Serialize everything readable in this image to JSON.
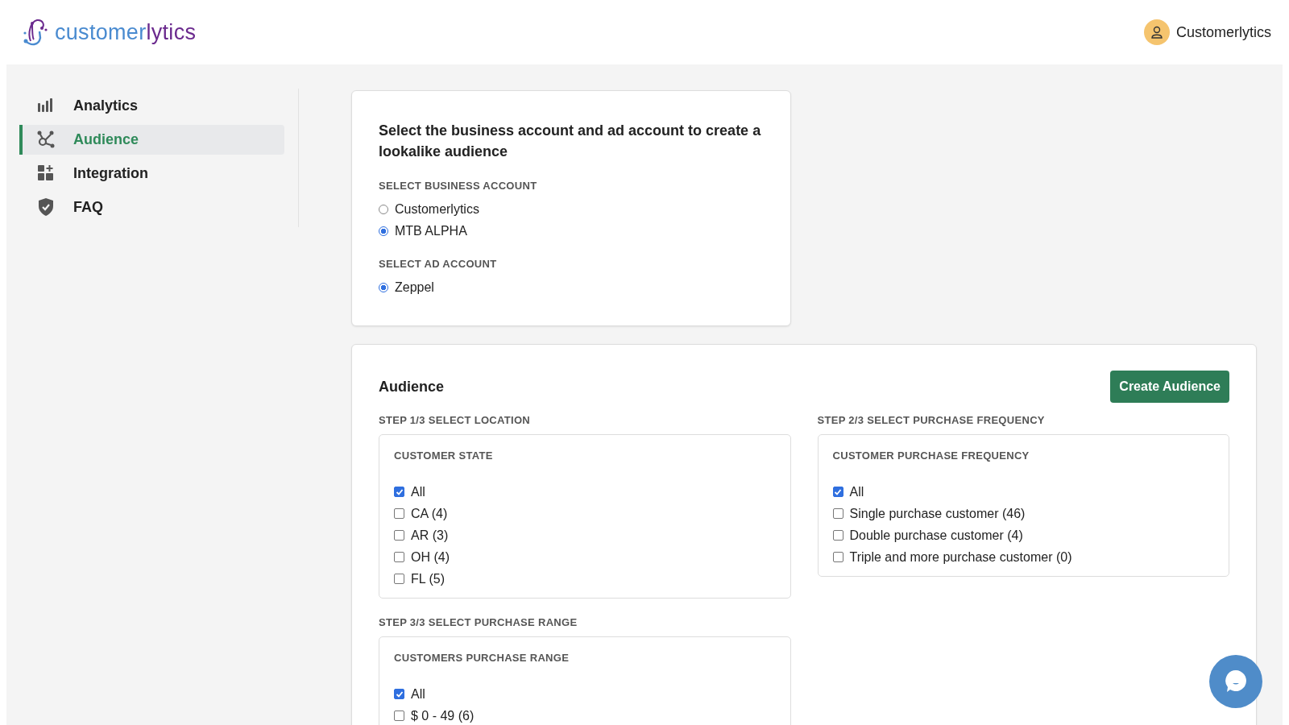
{
  "header": {
    "logo": [
      "customer",
      "lytics"
    ],
    "user_name": "Customerlytics"
  },
  "sidebar": {
    "items": [
      {
        "label": "Analytics",
        "selected": false
      },
      {
        "label": "Audience",
        "selected": true
      },
      {
        "label": "Integration",
        "selected": false
      },
      {
        "label": "FAQ",
        "selected": false
      }
    ]
  },
  "account_card": {
    "title": "Select the business account and ad account to create a lookalike audience",
    "groups": [
      {
        "label": "SELECT BUSINESS ACCOUNT",
        "options": [
          {
            "label": "Customerlytics",
            "selected": false
          },
          {
            "label": "MTB ALPHA",
            "selected": true
          }
        ]
      },
      {
        "label": "SELECT AD ACCOUNT",
        "options": [
          {
            "label": "Zeppel",
            "selected": true
          }
        ]
      }
    ]
  },
  "audience_card": {
    "title": "Audience",
    "button": "Create Audience",
    "steps": [
      {
        "label": "STEP 1/3 SELECT LOCATION",
        "box_title": "CUSTOMER STATE",
        "options": [
          {
            "label": "All",
            "checked": true
          },
          {
            "label": "CA (4)",
            "checked": false
          },
          {
            "label": "AR (3)",
            "checked": false
          },
          {
            "label": "OH (4)",
            "checked": false
          },
          {
            "label": "FL (5)",
            "checked": false
          }
        ]
      },
      {
        "label": "STEP 2/3 SELECT PURCHASE FREQUENCY",
        "box_title": "CUSTOMER PURCHASE FREQUENCY",
        "options": [
          {
            "label": "All",
            "checked": true
          },
          {
            "label": "Single purchase customer (46)",
            "checked": false
          },
          {
            "label": "Double purchase customer (4)",
            "checked": false
          },
          {
            "label": "Triple and more purchase customer (0)",
            "checked": false
          }
        ]
      },
      {
        "label": "STEP 3/3 SELECT PURCHASE RANGE",
        "box_title": "CUSTOMERS PURCHASE RANGE",
        "options": [
          {
            "label": "All",
            "checked": true
          },
          {
            "label": "$ 0 - 49 (6)",
            "checked": false
          }
        ]
      }
    ]
  }
}
